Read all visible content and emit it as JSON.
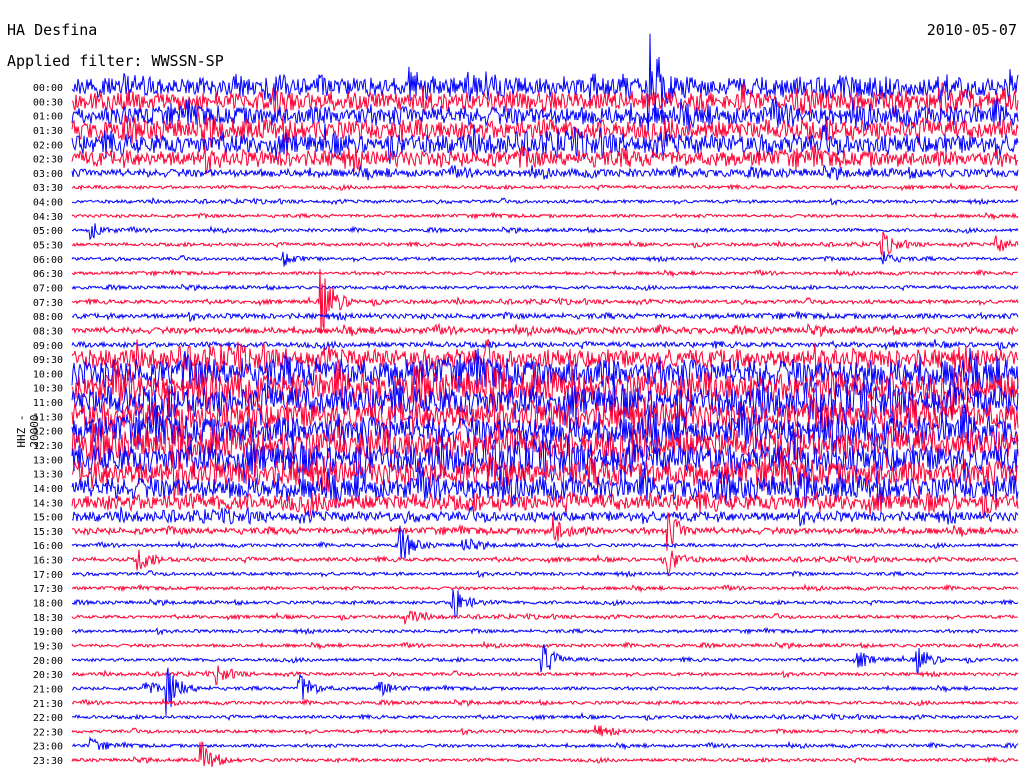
{
  "header": {
    "station": "HA Desfina",
    "date": "2010-05-07",
    "filter": "Applied filter: WWSSN-SP"
  },
  "chart_data": {
    "type": "line",
    "title": "HA Desfina",
    "ylabel": "HHZ - 20000",
    "xlabel": "",
    "minutes_per_line": 30,
    "colors": [
      "#0000ff",
      "#ff0033"
    ],
    "row_labels": [
      "00:00",
      "00:30",
      "01:00",
      "01:30",
      "02:00",
      "02:30",
      "03:00",
      "03:30",
      "04:00",
      "04:30",
      "05:00",
      "05:30",
      "06:00",
      "06:30",
      "07:00",
      "07:30",
      "08:00",
      "08:30",
      "09:00",
      "09:30",
      "10:00",
      "10:30",
      "11:00",
      "11:30",
      "12:00",
      "12:30",
      "13:00",
      "13:30",
      "14:00",
      "14:30",
      "15:00",
      "15:30",
      "16:00",
      "16:30",
      "17:00",
      "17:30",
      "18:00",
      "18:30",
      "19:00",
      "19:30",
      "20:00",
      "20:30",
      "21:00",
      "21:30",
      "22:00",
      "22:30",
      "23:00",
      "23:30"
    ],
    "noise_level": [
      6,
      6,
      6,
      6,
      6,
      5,
      2.5,
      1,
      1,
      1,
      1,
      1,
      1,
      1,
      1,
      1.2,
      1.6,
      2,
      1.6,
      6,
      9,
      9,
      9,
      9,
      9,
      9,
      9,
      8,
      7,
      5,
      3,
      2,
      1,
      1.2,
      1,
      1,
      1,
      1,
      1,
      1,
      1,
      1,
      1,
      1,
      1,
      1,
      1,
      1
    ],
    "events": [
      {
        "row": 0,
        "minute": 18.3,
        "amp": 30
      },
      {
        "row": 10,
        "minute": 0.6,
        "amp": 5
      },
      {
        "row": 11,
        "minute": 25.7,
        "amp": 7
      },
      {
        "row": 11,
        "minute": 29.3,
        "amp": 5
      },
      {
        "row": 12,
        "minute": 6.7,
        "amp": 4
      },
      {
        "row": 12,
        "minute": 25.7,
        "amp": 4
      },
      {
        "row": 15,
        "minute": 7.9,
        "amp": 20
      },
      {
        "row": 31,
        "minute": 15.3,
        "amp": 8
      },
      {
        "row": 31,
        "minute": 18.9,
        "amp": 10
      },
      {
        "row": 32,
        "minute": 10.4,
        "amp": 10
      },
      {
        "row": 32,
        "minute": 12.4,
        "amp": 4
      },
      {
        "row": 33,
        "minute": 2.1,
        "amp": 6
      },
      {
        "row": 33,
        "minute": 18.9,
        "amp": 8
      },
      {
        "row": 36,
        "minute": 12.05,
        "amp": 12
      },
      {
        "row": 37,
        "minute": 10.6,
        "amp": 5
      },
      {
        "row": 40,
        "minute": 14.9,
        "amp": 10
      },
      {
        "row": 40,
        "minute": 24.9,
        "amp": 5
      },
      {
        "row": 40,
        "minute": 26.8,
        "amp": 8
      },
      {
        "row": 41,
        "minute": 4.6,
        "amp": 5
      },
      {
        "row": 42,
        "minute": 2.3,
        "amp": 4
      },
      {
        "row": 42,
        "minute": 3.0,
        "amp": 14
      },
      {
        "row": 42,
        "minute": 7.2,
        "amp": 10
      },
      {
        "row": 42,
        "minute": 9.7,
        "amp": 5
      },
      {
        "row": 45,
        "minute": 16.6,
        "amp": 4
      },
      {
        "row": 46,
        "minute": 0.6,
        "amp": 4
      },
      {
        "row": 47,
        "minute": 4.1,
        "amp": 10
      }
    ]
  }
}
